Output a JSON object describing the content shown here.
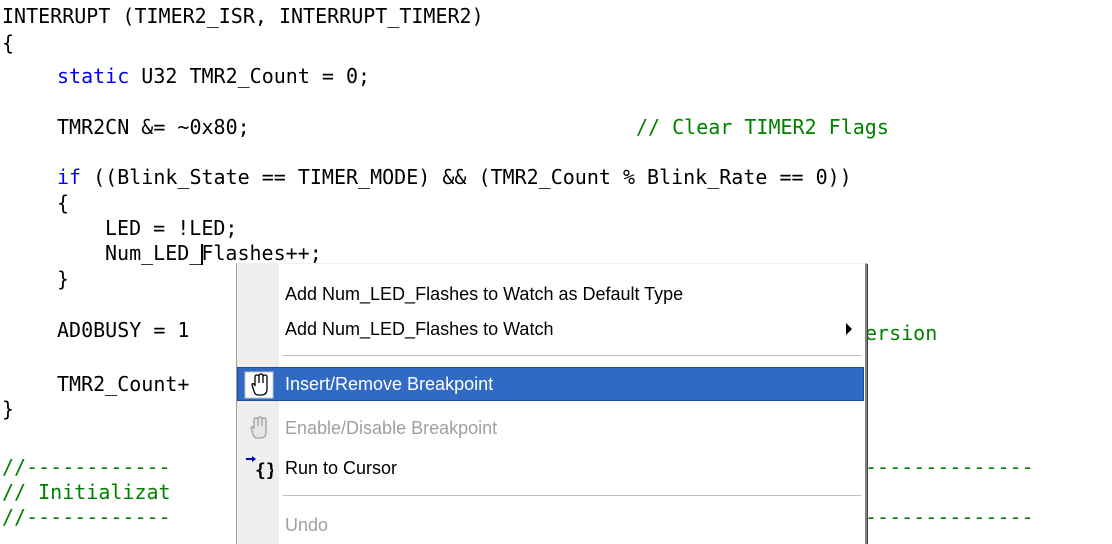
{
  "code": {
    "l1": "INTERRUPT (TIMER2_ISR, INTERRUPT_TIMER2)",
    "l2": "{",
    "l3_kw": "static",
    "l3_rest": " U32 TMR2_Count = 0;",
    "l4_code": "TMR2CN &= ~0x80;",
    "l4_comment": "// Clear TIMER2 Flags",
    "l5_kw": "if",
    "l5_rest": " ((Blink_State == TIMER_MODE) && (TMR2_Count % Blink_Rate == 0))",
    "l6": "{",
    "l7": "LED = !LED;",
    "l8_before": "Num_LED_",
    "l8_after": "Flashes++;",
    "l9": "}",
    "l10_code": "AD0BUSY = 1",
    "l10_comment": "ersion",
    "l11": "TMR2_Count+",
    "l12": "}",
    "l13_left": "//------------",
    "l13_right": "--------------",
    "l14_left": "// Initializat",
    "l15_left": "//------------",
    "l15_right": "--------------"
  },
  "context_menu": {
    "items": [
      {
        "label": "Add Num_LED_Flashes to Watch as Default Type",
        "enabled": true
      },
      {
        "label": "Add Num_LED_Flashes to Watch",
        "enabled": true,
        "submenu": true
      },
      {
        "label": "Insert/Remove Breakpoint",
        "enabled": true,
        "highlighted": true,
        "icon": "hand-breakpoint-icon"
      },
      {
        "label": "Enable/Disable Breakpoint",
        "enabled": false,
        "icon": "hand-breakpoint-disabled-icon"
      },
      {
        "label": "Run to Cursor",
        "enabled": true,
        "icon": "run-to-cursor-icon"
      },
      {
        "label": "Undo",
        "enabled": false
      }
    ]
  },
  "colors": {
    "keyword": "#0000ff",
    "comment": "#008000",
    "highlight": "#316ac5"
  }
}
